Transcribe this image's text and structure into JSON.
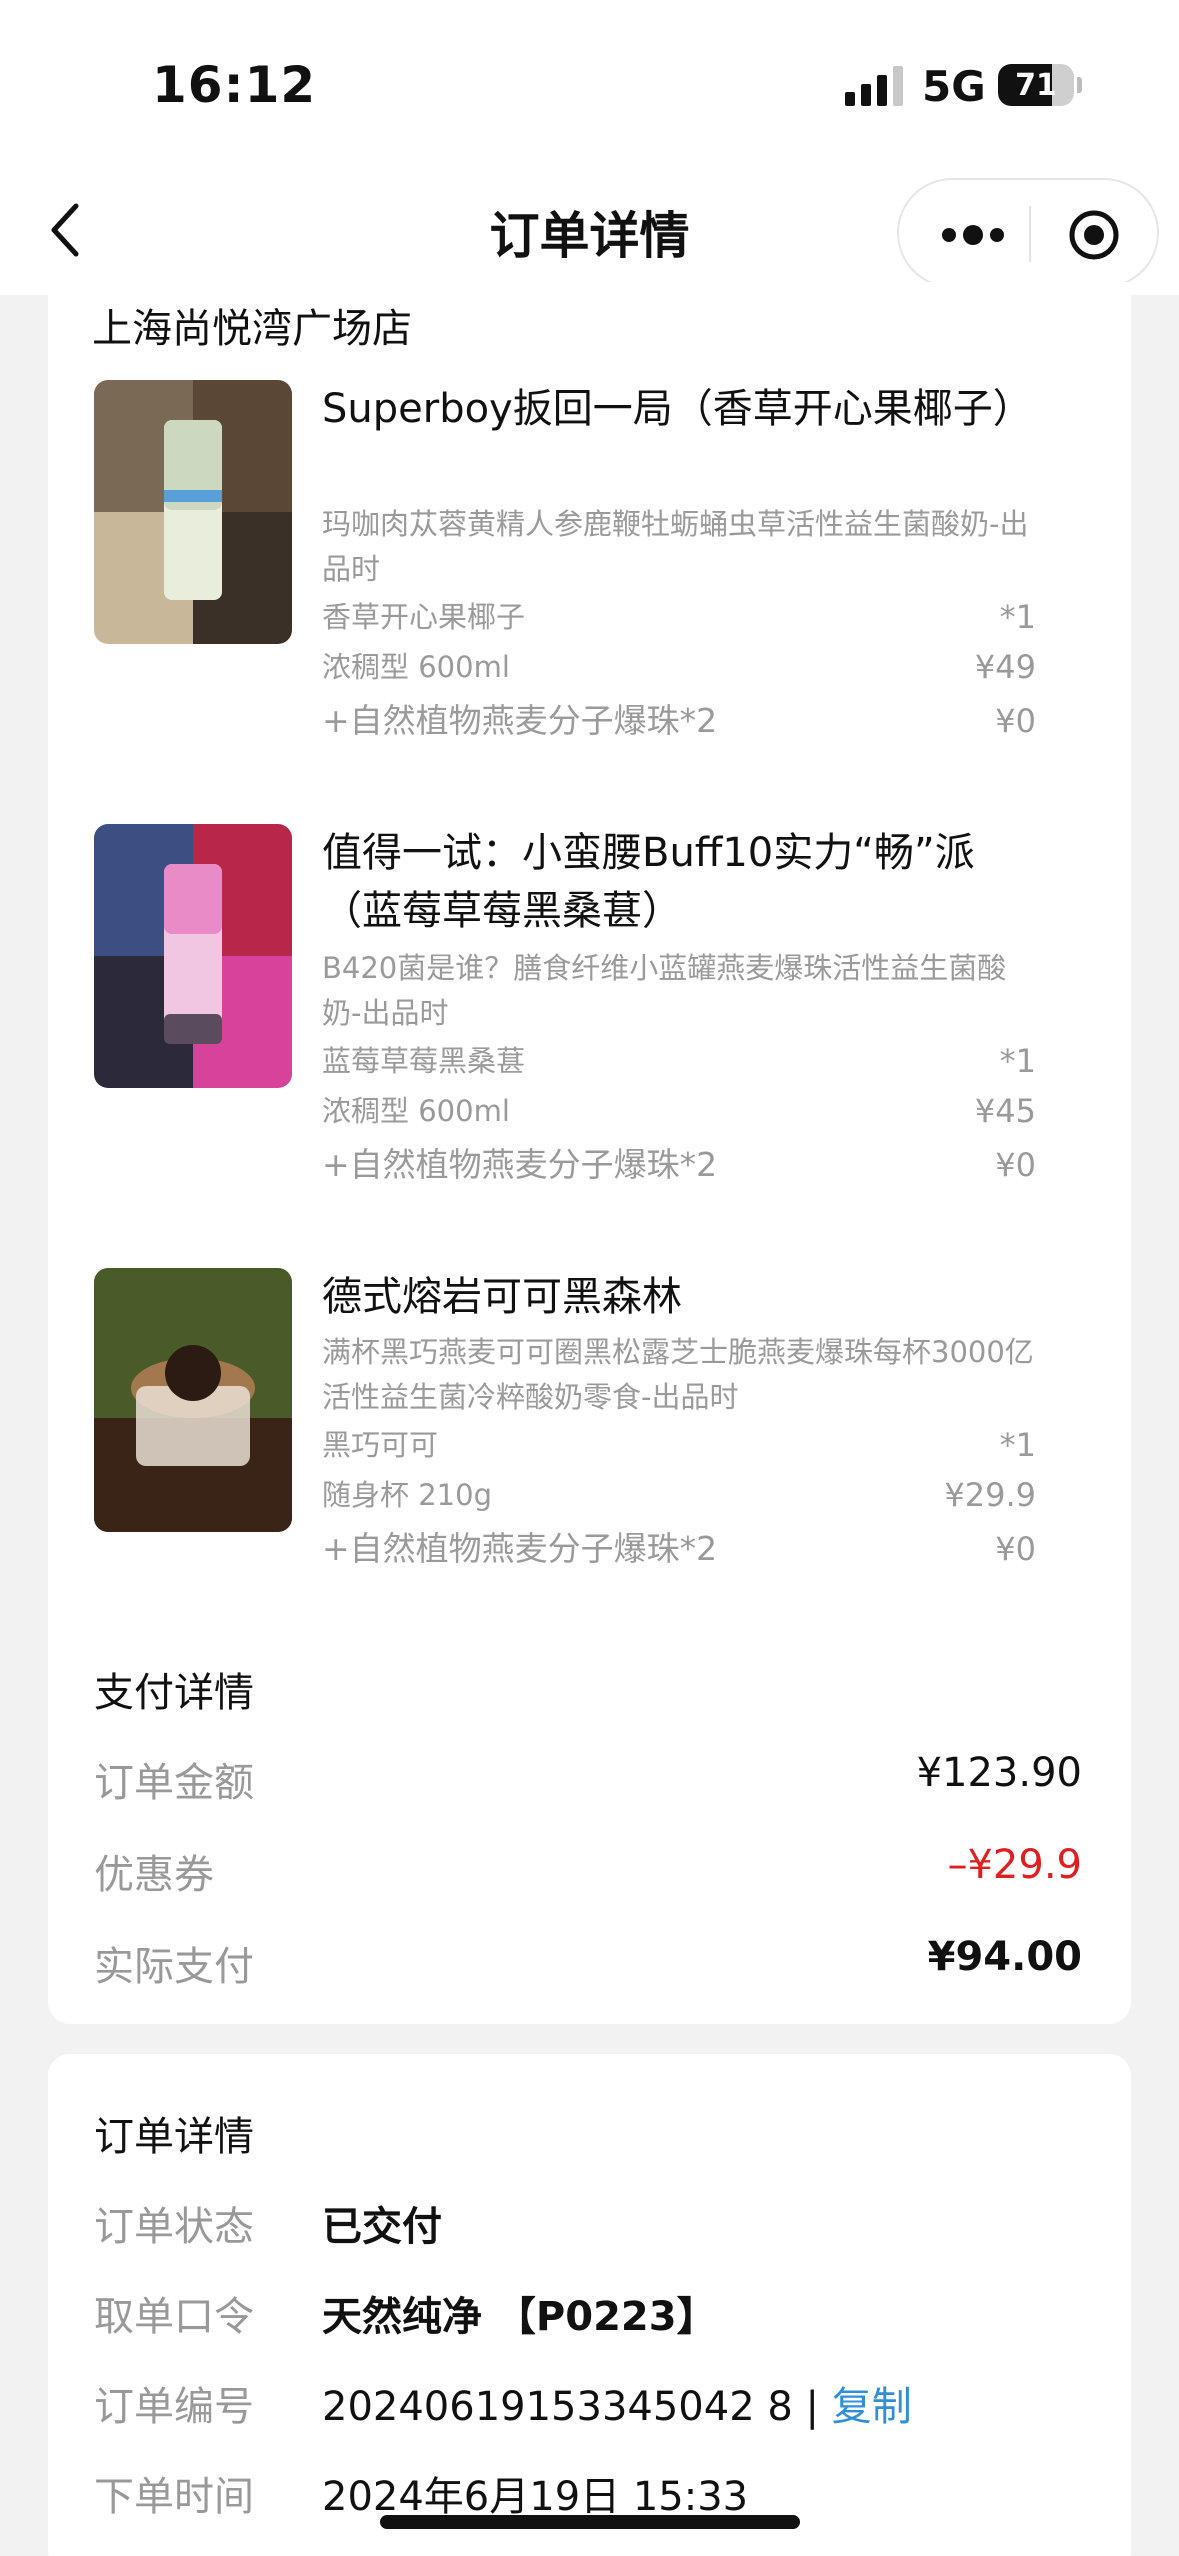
{
  "status": {
    "time": "16:12",
    "network": "5G",
    "battery": "71",
    "battery_level": 0.71
  },
  "nav": {
    "title": "订单详情",
    "more_icon": "more-dots-icon",
    "close_icon": "target-icon"
  },
  "store": "上海尚悦湾广场店",
  "products": [
    {
      "name": "Superboy扳回一局（香草开心果椰子）",
      "desc": "玛咖肉苁蓉黄精人参鹿鞭牡蛎蛹虫草活性益生菌酸奶-出品时",
      "flavor": "香草开心果椰子",
      "qty": "*1",
      "size": "浓稠型 600ml",
      "price": "¥49",
      "addon": "+自然植物燕麦分子爆珠*2",
      "addon_price": "¥0",
      "colors": [
        "#7a6a55",
        "#c9b79a",
        "#e9eddc",
        "#5b4736"
      ]
    },
    {
      "name": "值得一试：小蛮腰Buff10实力“畅”派（蓝莓草莓黑桑葚）",
      "desc": "B420菌是谁？膳食纤维小蓝罐燕麦爆珠活性益生菌酸奶-出品时",
      "flavor": "蓝莓草莓黑桑葚",
      "qty": "*1",
      "size": "浓稠型 600ml",
      "price": "¥45",
      "addon": "+自然植物燕麦分子爆珠*2",
      "addon_price": "¥0",
      "colors": [
        "#3c4f82",
        "#d7439a",
        "#f1c6e3",
        "#b8274a"
      ]
    },
    {
      "name": "德式熔岩可可黑森林",
      "desc": "满杯黑巧燕麦可可圈黑松露芝士脆燕麦爆珠每杯3000亿活性益生菌冷粹酸奶零食-出品时",
      "flavor": "黑巧可可",
      "qty": "*1",
      "size": "随身杯 210g",
      "price": "¥29.9",
      "addon": "+自然植物燕麦分子爆珠*2",
      "addon_price": "¥0",
      "colors": [
        "#4a5b2a",
        "#3a2418",
        "#a4784e",
        "#2b1b12"
      ]
    }
  ],
  "payment": {
    "title": "支付详情",
    "order_amount_label": "订单金额",
    "order_amount": "¥123.90",
    "coupon_label": "优惠券",
    "coupon": "–¥29.9",
    "paid_label": "实际支付",
    "paid": "¥94.00"
  },
  "order_info": {
    "title": "订单详情",
    "status_label": "订单状态",
    "status": "已交付",
    "code_label": "取单口令",
    "code": "天然纯净 【P0223】",
    "number_label": "订单编号",
    "number": "20240619153345042 8",
    "copy": "复制",
    "time_label": "下单时间",
    "time": "2024年6月19日 15:33"
  }
}
